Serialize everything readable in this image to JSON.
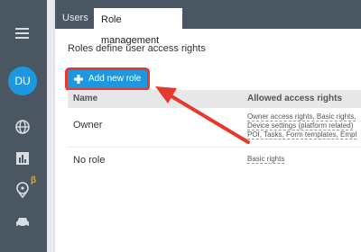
{
  "sidebar": {
    "items": [
      {
        "icon": "hamburger-menu-icon"
      },
      {
        "icon": "globe-icon"
      },
      {
        "icon": "bar-chart-icon"
      },
      {
        "icon": "map-pin-icon"
      },
      {
        "icon": "car-icon"
      }
    ],
    "avatar_initials": "DU",
    "beta_label": "β"
  },
  "tabs": [
    {
      "label": "Users",
      "active": false
    },
    {
      "label": "Role management",
      "active": true
    }
  ],
  "description": "Roles define user access rights",
  "add_role_button": {
    "label": "Add new role",
    "icon": "plus-icon"
  },
  "table": {
    "columns": [
      "Name",
      "Allowed access rights"
    ],
    "rows": [
      {
        "name": "Owner",
        "rights_lines": [
          "Owner access rights, Basic rights,",
          "Device settings (platform related)",
          "POI, Tasks, Form templates, Empl"
        ]
      },
      {
        "name": "No role",
        "rights_lines": [
          "Basic rights"
        ]
      }
    ]
  },
  "colors": {
    "sidebar": "#4a5763",
    "accent": "#1b98df",
    "annotation": "#e53a2d"
  }
}
